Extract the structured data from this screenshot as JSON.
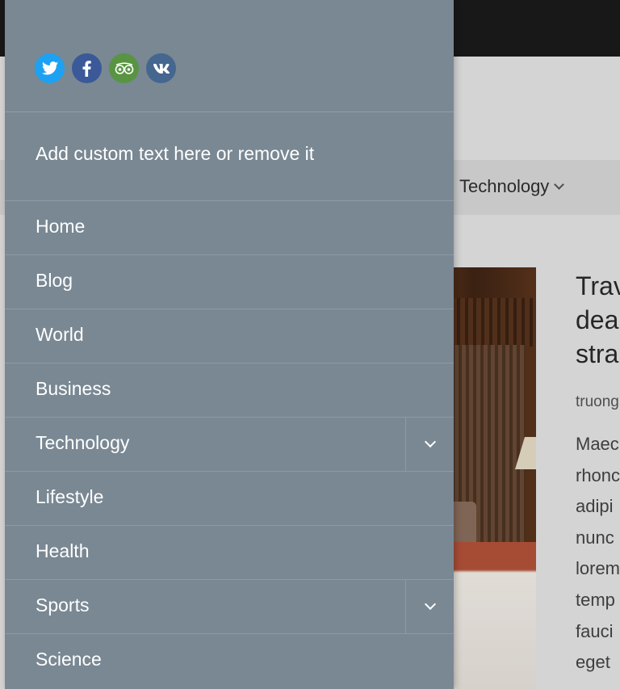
{
  "background": {
    "nav_item": "Technology",
    "article": {
      "title_lines": [
        "Trav",
        "dea",
        "stra"
      ],
      "author": "truong",
      "excerpt_lines": [
        "Maec",
        "rhonc",
        "adipi",
        "nunc",
        "lorem",
        "temp",
        "fauci",
        "eget"
      ]
    }
  },
  "drawer": {
    "social_icons": [
      {
        "name": "twitter-icon",
        "color": "#1da1f2"
      },
      {
        "name": "facebook-icon",
        "color": "#3b5998"
      },
      {
        "name": "tripadvisor-icon",
        "color": "#589442"
      },
      {
        "name": "vk-icon",
        "color": "#45668e"
      }
    ],
    "custom_text": "Add custom text here or remove it",
    "menu": [
      {
        "label": "Home",
        "has_submenu": false
      },
      {
        "label": "Blog",
        "has_submenu": false
      },
      {
        "label": "World",
        "has_submenu": false
      },
      {
        "label": "Business",
        "has_submenu": false
      },
      {
        "label": "Technology",
        "has_submenu": true
      },
      {
        "label": "Lifestyle",
        "has_submenu": false
      },
      {
        "label": "Health",
        "has_submenu": false
      },
      {
        "label": "Sports",
        "has_submenu": true
      },
      {
        "label": "Science",
        "has_submenu": false
      }
    ]
  },
  "colors": {
    "drawer_bg": "#798893",
    "topbar_bg": "#1b1b1b"
  }
}
